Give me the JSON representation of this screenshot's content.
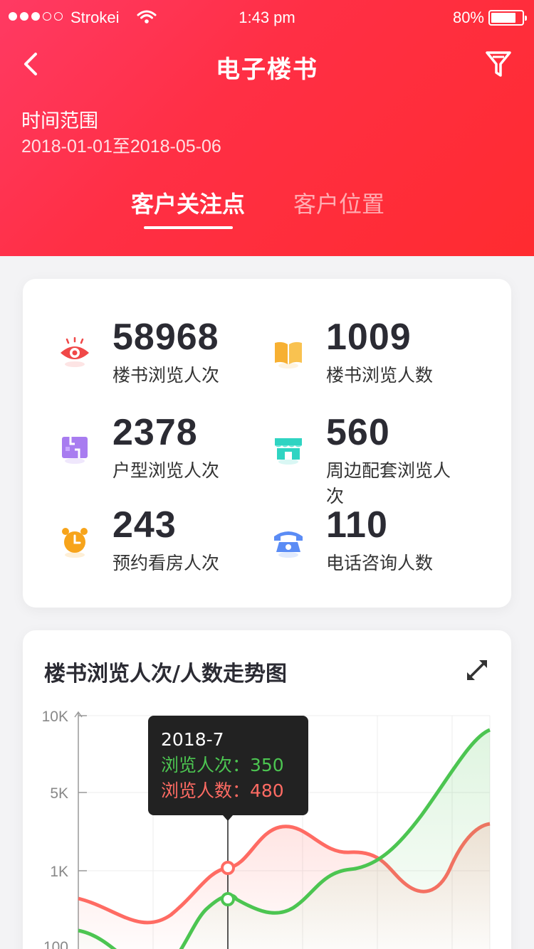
{
  "status_bar": {
    "carrier": "Strokei",
    "time": "1:43 pm",
    "battery": "80%",
    "battery_level": 0.8
  },
  "navbar": {
    "title": "电子楼书"
  },
  "date_range": {
    "label": "时间范围",
    "value": "2018-01-01至2018-05-06"
  },
  "tabs": [
    {
      "label": "客户关注点",
      "active": true
    },
    {
      "label": "客户位置",
      "active": false
    }
  ],
  "stats": [
    {
      "value": "58968",
      "label": "楼书浏览人次",
      "icon": "eye-icon",
      "color": "#f04848"
    },
    {
      "value": "1009",
      "label": "楼书浏览人数",
      "icon": "book-icon",
      "color": "#f7b032"
    },
    {
      "value": "2378",
      "label": "户型浏览人次",
      "icon": "floorplan-icon",
      "color": "#a87cf0"
    },
    {
      "value": "560",
      "label": "周边配套浏览人次",
      "icon": "store-icon",
      "color": "#2fd4c2"
    },
    {
      "value": "243",
      "label": "预约看房人次",
      "icon": "alarm-clock-icon",
      "color": "#f7a41b"
    },
    {
      "value": "110",
      "label": "电话咨询人数",
      "icon": "phone-icon",
      "color": "#5b8cf5"
    }
  ],
  "trend_chart": {
    "title": "楼书浏览人次/人数走势图",
    "tooltip": {
      "period": "2018-7",
      "line1": "浏览人次：350",
      "line2": "浏览人数：480"
    }
  },
  "chart_data": {
    "type": "line",
    "y_scale": "log",
    "y_ticks": [
      "10K",
      "5K",
      "1K",
      "100"
    ],
    "series": [
      {
        "name": "浏览人次",
        "color": "#4cc551"
      },
      {
        "name": "浏览人数",
        "color": "#ff6b63"
      }
    ],
    "highlighted": {
      "x": "2018-7",
      "浏览人次": 350,
      "浏览人数": 480
    }
  },
  "colors": {
    "brand": "#ff2f45",
    "green": "#4cc551",
    "red": "#ff6b63"
  }
}
